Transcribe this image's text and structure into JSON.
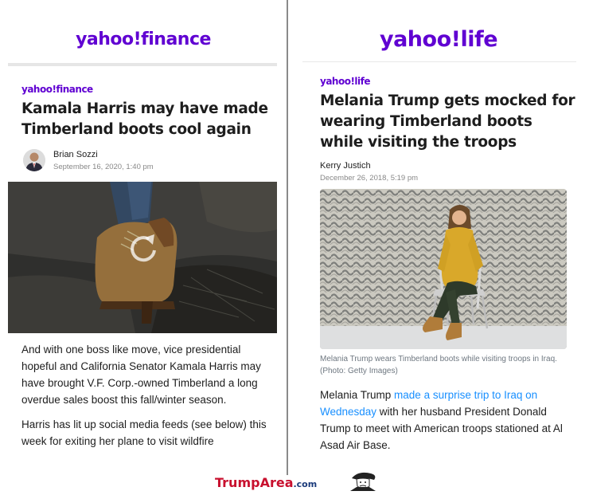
{
  "left": {
    "brand": "yahoo!finance",
    "article_brand": "yahoo!finance",
    "headline": "Kamala Harris may have made Timberland boots cool again",
    "author": "Brian Sozzi",
    "date": "September 16, 2020, 1:40 pm",
    "paragraph1": "And with one boss like move, vice presidential hopeful and California Senator Kamala Harris may have brought V.F. Corp.-owned Timberland a long overdue sales boost this fall/winter season.",
    "paragraph2": "Harris has lit up social media feeds (see below) this week for exiting her plane to visit wildfire"
  },
  "right": {
    "brand": "yahoo!life",
    "article_brand": "yahoo!life",
    "headline": "Melania Trump gets mocked for wearing Timberland boots while visiting the troops",
    "author": "Kerry Justich",
    "date": "December 26, 2018, 5:19 pm",
    "caption": "Melania Trump wears Timberland boots while visiting troops in Iraq. (Photo: Getty Images)",
    "p_start": "Melania Trump ",
    "p_link": "made a surprise trip to Iraq on Wednesday",
    "p_end": " with her husband President Donald Trump to meet with American troops stationed at Al Asad Air Base."
  },
  "footer": {
    "brand_main": "TrumpArea",
    "brand_suffix": ".com"
  },
  "colors": {
    "yahoo_purple": "#6001d2",
    "link_blue": "#188fff",
    "footer_red": "#c8102e"
  }
}
